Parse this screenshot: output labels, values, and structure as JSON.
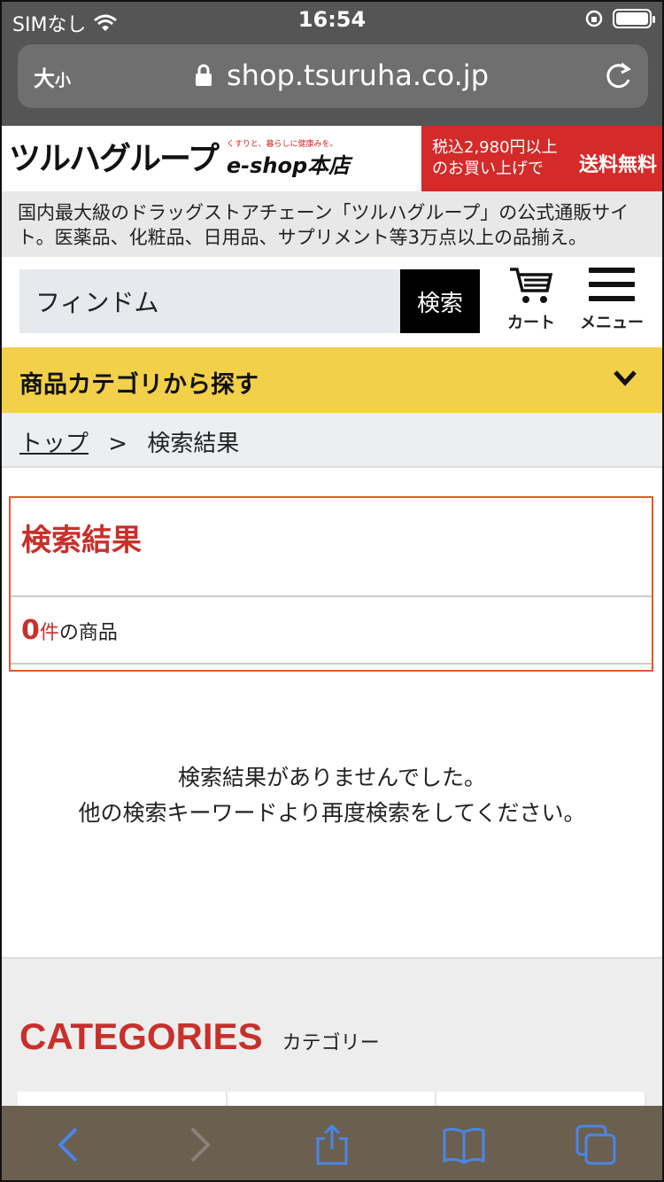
{
  "status": {
    "carrier": "SIMなし",
    "time": "16:54"
  },
  "browser": {
    "text_size_label": "大",
    "text_size_small": "小",
    "url": "shop.tsuruha.co.jp"
  },
  "header": {
    "logo_main": "ツルハグループ",
    "logo_tag": "くすりと、暮らしに健康みを。",
    "logo_shop": "e-shop本店",
    "promo_line1": "税込2,980円以上",
    "promo_line2": "のお買い上げで",
    "promo_free": "送料無料"
  },
  "intro": "国内最大級のドラッグストアチェーン「ツルハグループ」の公式通販サイト。医薬品、化粧品、日用品、サプリメント等3万点以上の品揃え。",
  "search": {
    "value": "フィンドム",
    "button_label": "検索"
  },
  "nav": {
    "cart_label": "カート",
    "menu_label": "メニュー"
  },
  "category_bar": {
    "label": "商品カテゴリから探す"
  },
  "breadcrumb": {
    "home": "トップ",
    "separator": ">",
    "current": "検索結果"
  },
  "results": {
    "title": "検索結果",
    "count": "0",
    "count_unit": "件",
    "count_suffix": "の商品"
  },
  "empty_message": {
    "line1": "検索結果がありませんでした。",
    "line2": "他の検索キーワードより再度検索をしてください。"
  },
  "categories": {
    "title_en": "CATEGORIES",
    "title_jp": "カテゴリー"
  },
  "colors": {
    "accent_red": "#c8302b",
    "promo_red": "#d42a2a",
    "category_yellow": "#f2d04a"
  }
}
